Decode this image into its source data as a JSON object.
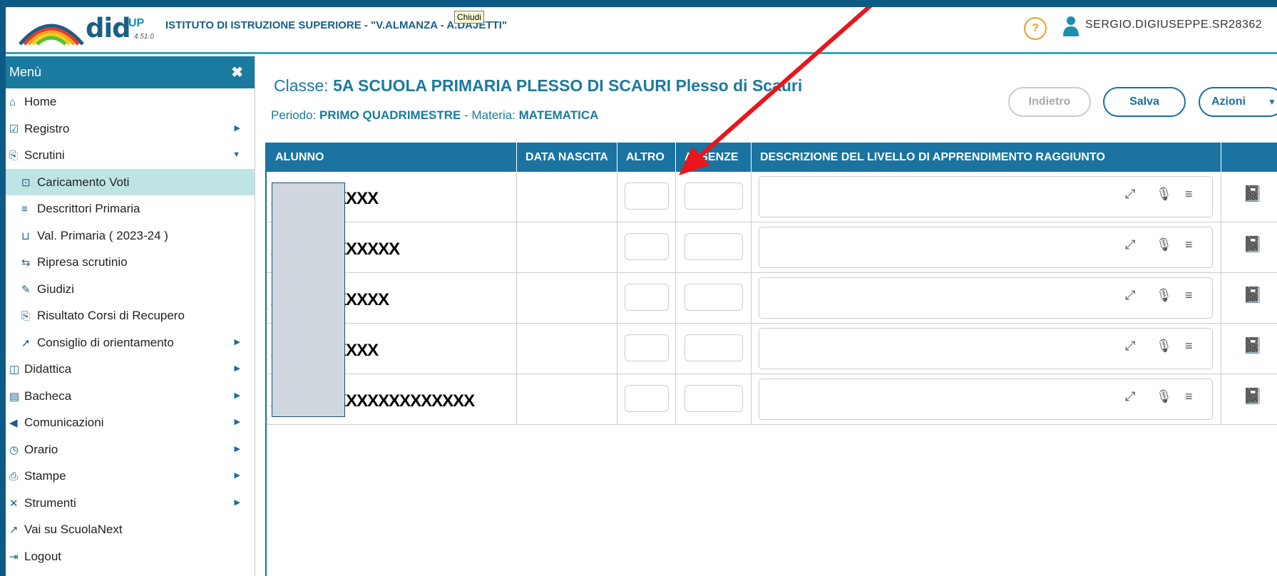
{
  "header": {
    "logo_text": "did",
    "logo_up": "UP",
    "version": "4.51.0",
    "school": "ISTITUTO DI ISTRUZIONE SUPERIORE - \"V.ALMANZA - A.DAJETTI\"",
    "tooltip": "Chiudi",
    "help_label": "?",
    "username": "SERGIO.DIGIUSEPPE.SR28362"
  },
  "sidebar": {
    "title": "Menù",
    "close_icon": "✖",
    "items": [
      {
        "label": "Home",
        "icon": "home-icon",
        "glyph": "⌂"
      },
      {
        "label": "Registro",
        "icon": "calendar-check-icon",
        "glyph": "☑"
      },
      {
        "label": "Scrutini",
        "icon": "document-export-icon",
        "glyph": "⎘"
      },
      {
        "label": "Caricamento Voti",
        "icon": "bookmark-icon",
        "glyph": "⊡"
      },
      {
        "label": "Descrittori Primaria",
        "icon": "list-icon",
        "glyph": "≡"
      },
      {
        "label": "Val. Primaria ( 2023-24 )",
        "icon": "book-icon",
        "glyph": "⊔"
      },
      {
        "label": "Ripresa scrutinio",
        "icon": "refresh-icon",
        "glyph": "⇆"
      },
      {
        "label": "Giudizi",
        "icon": "edit-icon",
        "glyph": "✎"
      },
      {
        "label": "Risultato Corsi di Recupero",
        "icon": "document-export-icon",
        "glyph": "⎘"
      },
      {
        "label": "Consiglio di orientamento",
        "icon": "pin-icon",
        "glyph": "➚"
      },
      {
        "label": "Didattica",
        "icon": "book-open-icon",
        "glyph": "◫"
      },
      {
        "label": "Bacheca",
        "icon": "newspaper-icon",
        "glyph": "▤"
      },
      {
        "label": "Comunicazioni",
        "icon": "megaphone-icon",
        "glyph": "◀"
      },
      {
        "label": "Orario",
        "icon": "clock-icon",
        "glyph": "◷"
      },
      {
        "label": "Stampe",
        "icon": "print-icon",
        "glyph": "⎙"
      },
      {
        "label": "Strumenti",
        "icon": "tools-icon",
        "glyph": "✕"
      },
      {
        "label": "Vai su ScuolaNext",
        "icon": "external-link-icon",
        "glyph": "↗"
      },
      {
        "label": "Logout",
        "icon": "logout-icon",
        "glyph": "⇥"
      }
    ]
  },
  "main": {
    "classe_label": "Classe: ",
    "classe_value": "5A SCUOLA PRIMARIA PLESSO DI SCAURI Plesso di Scauri",
    "periodo_label": "Periodo: ",
    "periodo_value": "PRIMO QUADRIMESTRE",
    "materia_label": " - Materia: ",
    "materia_value": "MATEMATICA",
    "btn_back": "Indietro",
    "btn_save": "Salva",
    "btn_actions": "Azioni"
  },
  "table": {
    "headers": [
      "ALUNNO",
      "DATA NASCITA",
      "ALTRO",
      "ASSENZE",
      "DESCRIZIONE DEL LIVELLO DI APPRENDIMENTO RAGGIUNTO",
      ""
    ],
    "rows": [
      {
        "name": "XXXXXXXXXX"
      },
      {
        "name": "XXXXXXXXXXXX"
      },
      {
        "name": "XXXXXXXXXXX"
      },
      {
        "name": "XXXXXXXXXX"
      },
      {
        "name": "XXXXXXXXXXXXXXXXXXX"
      }
    ]
  },
  "colors": {
    "accent": "#1a73a0",
    "active_menu": "#bfe4e4",
    "arrow": "#e8151b"
  }
}
